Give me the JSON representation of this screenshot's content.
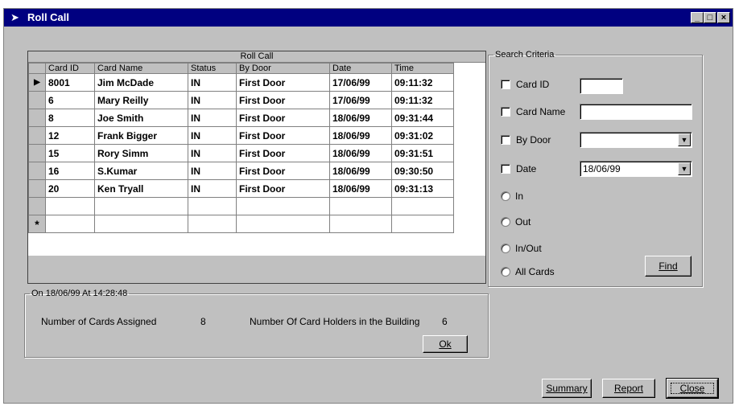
{
  "window": {
    "title": "Roll Call",
    "icon": "arrow-icon",
    "title_bar_color": "#000080"
  },
  "grid": {
    "caption": "Roll Call",
    "columns": [
      "Card ID",
      "Card Name",
      "Status",
      "By Door",
      "Date",
      "Time"
    ],
    "rows": [
      {
        "card_id": "8001",
        "card_name": "Jim McDade",
        "status": "IN",
        "by_door": "First Door",
        "date": "17/06/99",
        "time": "09:11:32"
      },
      {
        "card_id": "6",
        "card_name": "Mary Reilly",
        "status": "IN",
        "by_door": "First Door",
        "date": "17/06/99",
        "time": "09:11:32"
      },
      {
        "card_id": "8",
        "card_name": "Joe Smith",
        "status": "IN",
        "by_door": "First Door",
        "date": "18/06/99",
        "time": "09:31:44"
      },
      {
        "card_id": "12",
        "card_name": "Frank Bigger",
        "status": "IN",
        "by_door": "First Door",
        "date": "18/06/99",
        "time": "09:31:02"
      },
      {
        "card_id": "15",
        "card_name": "Rory Simm",
        "status": "IN",
        "by_door": "First Door",
        "date": "18/06/99",
        "time": "09:31:51"
      },
      {
        "card_id": "16",
        "card_name": "S.Kumar",
        "status": "IN",
        "by_door": "First Door",
        "date": "18/06/99",
        "time": "09:30:50"
      },
      {
        "card_id": "20",
        "card_name": "Ken Tryall",
        "status": "IN",
        "by_door": "First Door",
        "date": "18/06/99",
        "time": "09:31:13"
      }
    ],
    "current_row_marker": "▶",
    "new_row_marker": "*"
  },
  "search": {
    "legend": "Search Criteria",
    "card_id_label": "Card ID",
    "card_id_value": "",
    "card_name_label": "Card Name",
    "card_name_value": "",
    "by_door_label": "By Door",
    "by_door_value": "",
    "date_label": "Date",
    "date_value": "18/06/99",
    "in_label": "In",
    "out_label": "Out",
    "inout_label": "In/Out",
    "all_label": "All Cards",
    "find_label": "Find"
  },
  "summary_info": {
    "legend": "On 18/06/99 At 14:28:48",
    "cards_assigned_label": "Number of Cards Assigned",
    "cards_assigned_value": "8",
    "holders_label": "Number Of Card Holders in the Building",
    "holders_value": "6",
    "ok_label": "Ok"
  },
  "buttons": {
    "summary": "Summary",
    "report": "Report",
    "close": "Close"
  }
}
